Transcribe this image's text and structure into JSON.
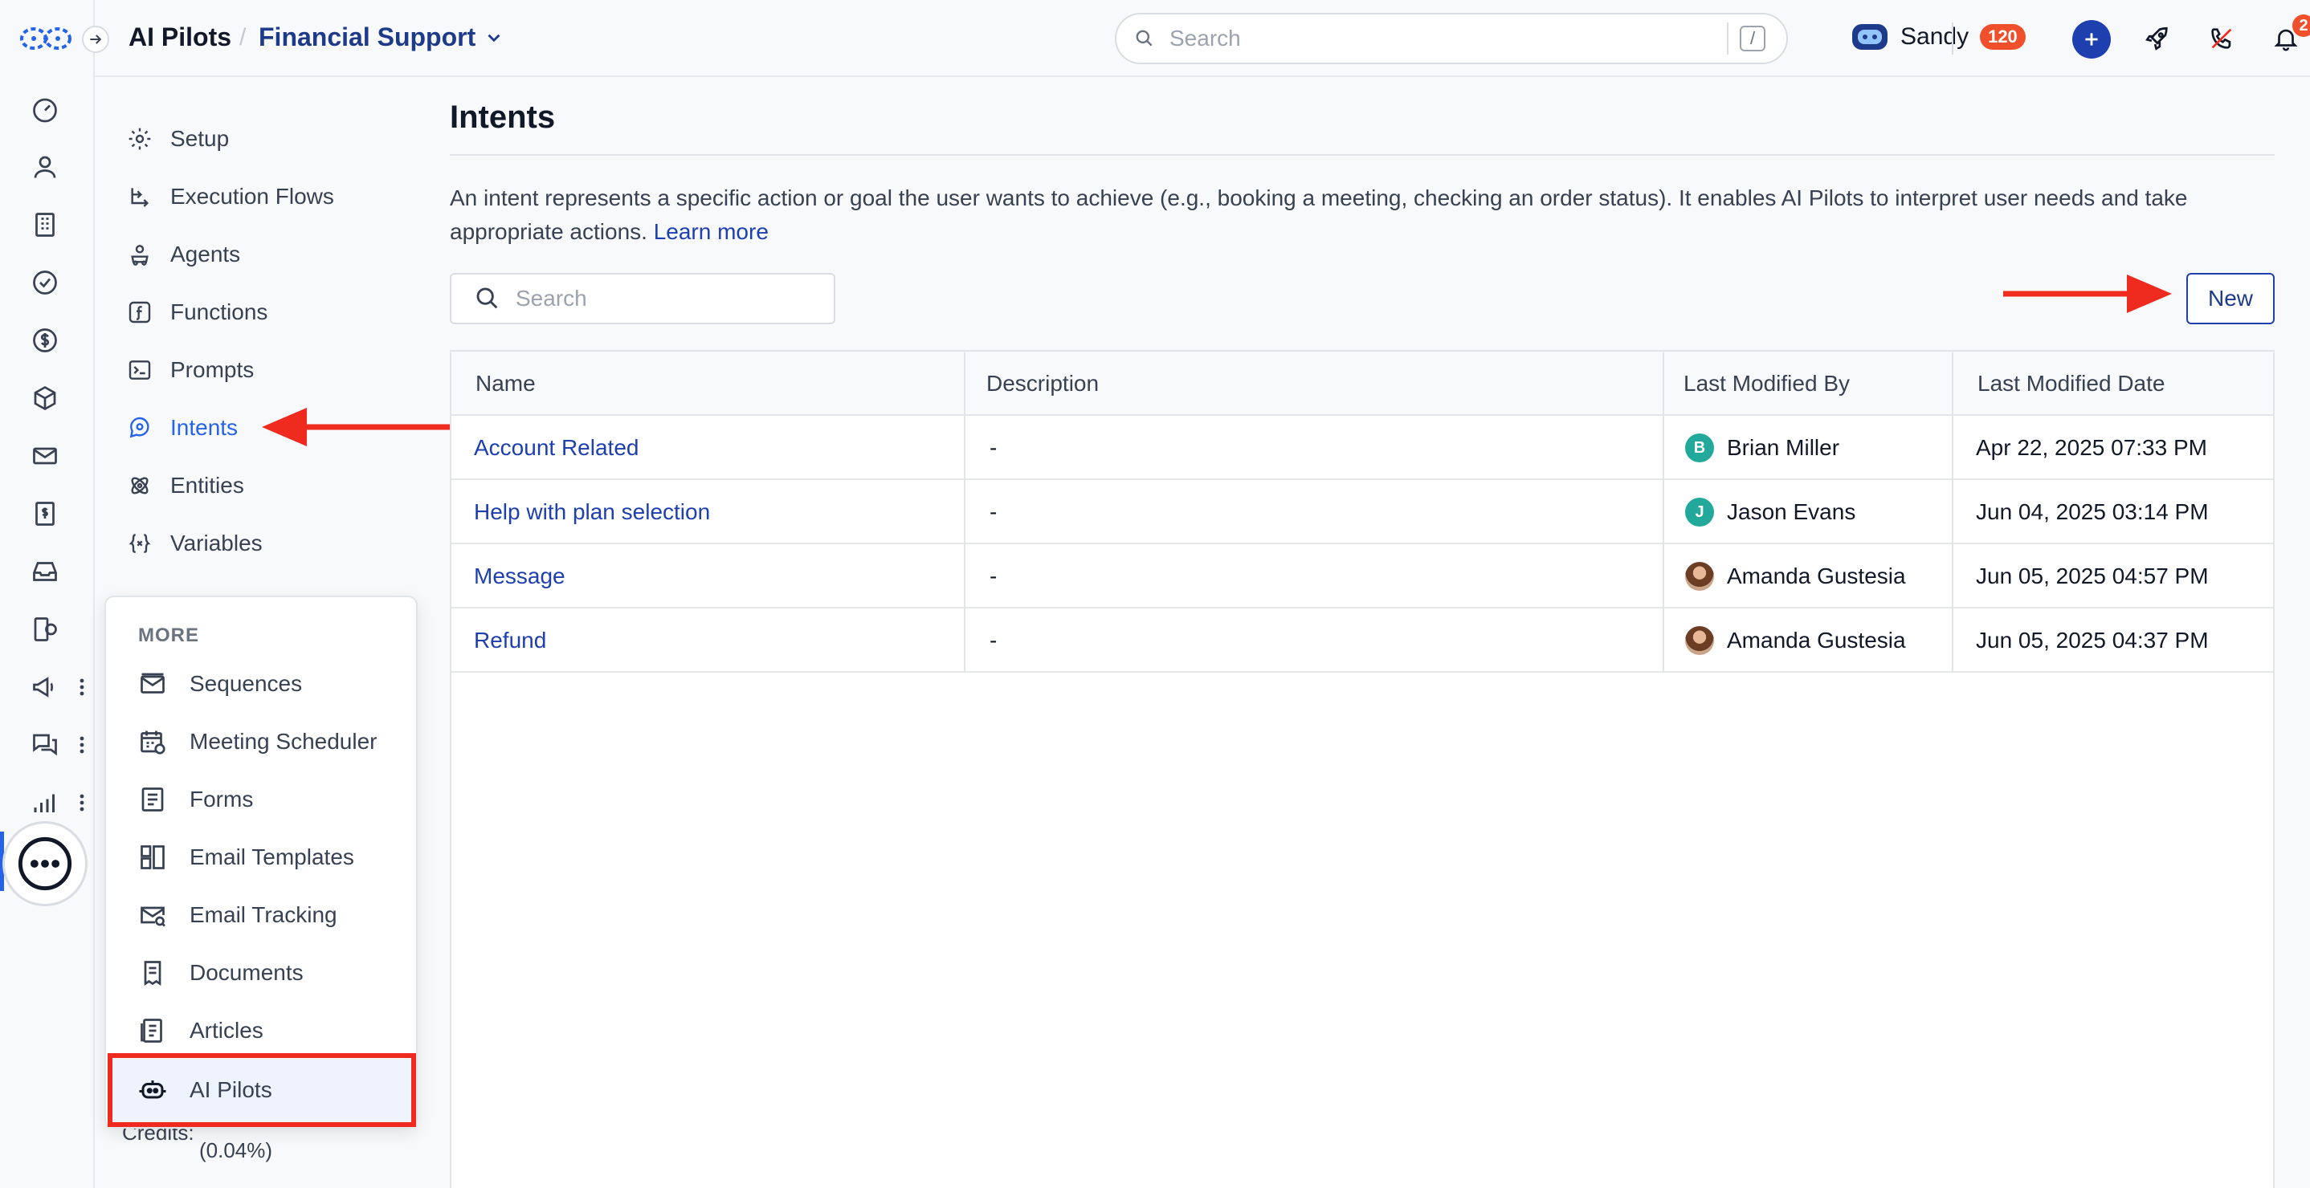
{
  "header": {
    "app_title": "AI Pilots",
    "workspace": "Financial Support",
    "search_placeholder": "Search",
    "search_shortcut": "/",
    "user_name": "Sandy",
    "user_badge": "120",
    "notification_count": "2"
  },
  "subnav": {
    "items": [
      {
        "label": "Setup",
        "icon": "gear-icon"
      },
      {
        "label": "Execution Flows",
        "icon": "flow-icon"
      },
      {
        "label": "Agents",
        "icon": "agent-icon"
      },
      {
        "label": "Functions",
        "icon": "function-icon"
      },
      {
        "label": "Prompts",
        "icon": "prompt-icon"
      },
      {
        "label": "Intents",
        "icon": "intent-icon",
        "active": true
      },
      {
        "label": "Entities",
        "icon": "entity-icon"
      },
      {
        "label": "Variables",
        "icon": "variable-icon"
      }
    ]
  },
  "more_menu": {
    "title": "MORE",
    "items": [
      {
        "label": "Sequences",
        "icon": "sequence-mail-icon"
      },
      {
        "label": "Meeting Scheduler",
        "icon": "calendar-icon"
      },
      {
        "label": "Forms",
        "icon": "form-icon"
      },
      {
        "label": "Email Templates",
        "icon": "template-icon"
      },
      {
        "label": "Email Tracking",
        "icon": "email-tracking-icon"
      },
      {
        "label": "Documents",
        "icon": "document-icon"
      },
      {
        "label": "Articles",
        "icon": "article-icon"
      },
      {
        "label": "AI Pilots",
        "icon": "bot-icon",
        "selected": true
      }
    ],
    "credits_label": "Credits:",
    "credits_value": "(0.04%)"
  },
  "main": {
    "title": "Intents",
    "description": "An intent represents a specific action or goal the user wants to achieve (e.g., booking a meeting, checking an order status). It enables AI Pilots to interpret user needs and take appropriate actions.",
    "learn_more": "Learn more",
    "search_placeholder": "Search",
    "new_button": "New",
    "table": {
      "columns": [
        "Name",
        "Description",
        "Last Modified By",
        "Last Modified Date"
      ],
      "rows": [
        {
          "name": "Account Related",
          "description": "-",
          "modified_by": "Brian Miller",
          "initial": "B",
          "date": "Apr 22, 2025 07:33 PM"
        },
        {
          "name": "Help with plan selection",
          "description": "-",
          "modified_by": "Jason Evans",
          "initial": "J",
          "date": "Jun 04, 2025 03:14 PM"
        },
        {
          "name": "Message",
          "description": "-",
          "modified_by": "Amanda Gustesia",
          "initial": "",
          "date": "Jun 05, 2025 04:57 PM"
        },
        {
          "name": "Refund",
          "description": "-",
          "modified_by": "Amanda Gustesia",
          "initial": "",
          "date": "Jun 05, 2025 04:37 PM"
        }
      ]
    }
  },
  "colors": {
    "accent": "#2563eb",
    "brand_dark": "#1e40af",
    "badge": "#f04f2b",
    "annotation": "#ef2b1f",
    "avatar_teal": "#22a99b"
  }
}
